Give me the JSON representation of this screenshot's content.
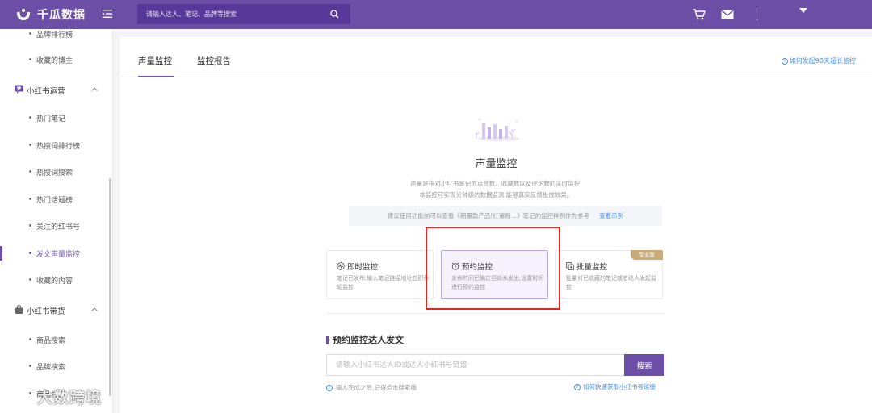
{
  "header": {
    "brand": "千瓜数据",
    "search_placeholder": "请输入达人、笔记、品牌等搜索"
  },
  "sidebar": {
    "items": [
      {
        "label": "品牌排行榜"
      },
      {
        "label": "收藏的博主"
      },
      {
        "label": "小红书运营"
      },
      {
        "label": "热门笔记"
      },
      {
        "label": "热搜词排行榜"
      },
      {
        "label": "热搜词搜索"
      },
      {
        "label": "热门话题榜"
      },
      {
        "label": "关注的红书号"
      },
      {
        "label": "发文声量监控"
      },
      {
        "label": "收藏的内容"
      },
      {
        "label": "小红书带货"
      },
      {
        "label": "商品搜索"
      },
      {
        "label": "品牌搜索"
      },
      {
        "label": "商品排行"
      }
    ]
  },
  "tabs": [
    {
      "label": "声量监控"
    },
    {
      "label": "监控报告"
    }
  ],
  "help_link": "如何发起90天超长监控",
  "intro": {
    "title": "声量监控",
    "desc_line1": "声量是指对小红书笔记的点赞数、收藏数以及评论数的实时监控,",
    "desc_line2": "本监控可实现分钟级的数据监测,能够真实反馈投放效果。",
    "notice": "建议使用功能前可以查看《期量款产品!红薯粉...》笔记的监控样例作为参考",
    "notice_link": "查看示例"
  },
  "cards": [
    {
      "title": "即时监控",
      "desc": "笔记已发布,输入笔记链接地址立即开始监控"
    },
    {
      "title": "预约监控",
      "desc": "发布时间已确定但尚未发出,设置时间进行预约监控"
    },
    {
      "title": "批量监控",
      "desc": "批量对已收藏的笔记或者达人发起监控",
      "badge": "专业版"
    }
  ],
  "form": {
    "title": "预约监控达人发文",
    "placeholder": "请输入小红书达人ID或达人小红书号链接",
    "button": "搜索",
    "tip": "输入完成之后,记得点击搜索哦",
    "link": "如何快速获取小红书号链接"
  },
  "watermark": "大数跨境",
  "colors": {
    "brand_purple": "#6e4fa8",
    "link_blue": "#4a8fe8",
    "highlight_red": "#e0261f",
    "pro_gold": "#c9a975"
  }
}
